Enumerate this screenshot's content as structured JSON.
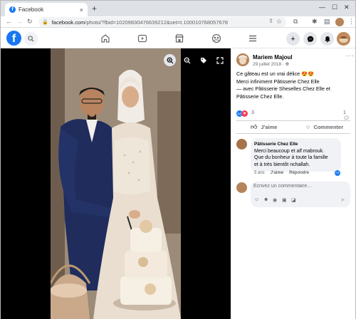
{
  "browser": {
    "tab_title": "Facebook",
    "url_host": "facebook.com",
    "url_path": "/photo/?fbid=10209830476639212&set=t.100010768057678",
    "new_tab": "+",
    "close_tab": "×"
  },
  "fb": {
    "logo": "f",
    "nav": [
      "home-icon",
      "watch-icon",
      "marketplace-icon",
      "groups-icon",
      "menu-icon"
    ],
    "right": [
      "create-icon",
      "messenger-icon",
      "notifications-icon",
      "account-avatar"
    ]
  },
  "post": {
    "author": "Mariem Majoul",
    "date": "29 juillet 2018 · ",
    "more": "···",
    "text_lines": [
      "Ce gâteau est un vrai délice 😍😍",
      "Merci infiniment Pâtisserie Chez Elle"
    ],
    "tag_lines": [
      "— avec Pâtisserie Sheselles Chez Elle et",
      "Pâtisserie Chez Elle."
    ],
    "reaction_count": "3",
    "comment_count": "1",
    "like_label": "J'aime",
    "comment_label": "Commenter"
  },
  "comment": {
    "author": "Pâtisserie Chez Elle",
    "lines": [
      "Merci beaucoup et alf mabrouk.",
      "Que du bonheur à toute la famille",
      "et à très bientôt nchallah."
    ],
    "age": "5 ans",
    "like": "J'aime",
    "reply": "Répondre"
  },
  "composer": {
    "placeholder": "Écrivez un commentaire…"
  },
  "colors": {
    "fb_blue": "#1877f2",
    "love_red": "#f33e58"
  }
}
